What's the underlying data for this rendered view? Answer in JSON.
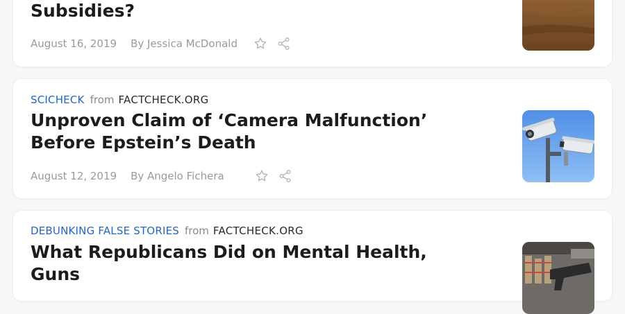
{
  "articles": [
    {
      "category": "",
      "from_label": "",
      "publisher": "",
      "title": "Subsidies?",
      "date": "August 16, 2019",
      "author": "By Jessica McDonald",
      "thumbnail": "wind-farm-image"
    },
    {
      "category": "SCICHECK",
      "from_label": "from",
      "publisher": "FACTCHECK.ORG",
      "title": "Unproven Claim of ‘Camera Malfunction’ Before Epstein’s Death",
      "date": "August 12, 2019",
      "author": "By Angelo Fichera",
      "thumbnail": "security-cameras-image"
    },
    {
      "category": "DEBUNKING FALSE STORIES",
      "from_label": "from",
      "publisher": "FACTCHECK.ORG",
      "title": "What Republicans Did on Mental Health, Guns",
      "date": "",
      "author": "",
      "thumbnail": "gun-store-image"
    }
  ],
  "colors": {
    "category": "#1f63e0",
    "headline": "#1c1c1c",
    "meta": "#9a9a9a",
    "background": "#f7f7f8"
  },
  "icons": [
    "star-icon",
    "share-icon"
  ]
}
